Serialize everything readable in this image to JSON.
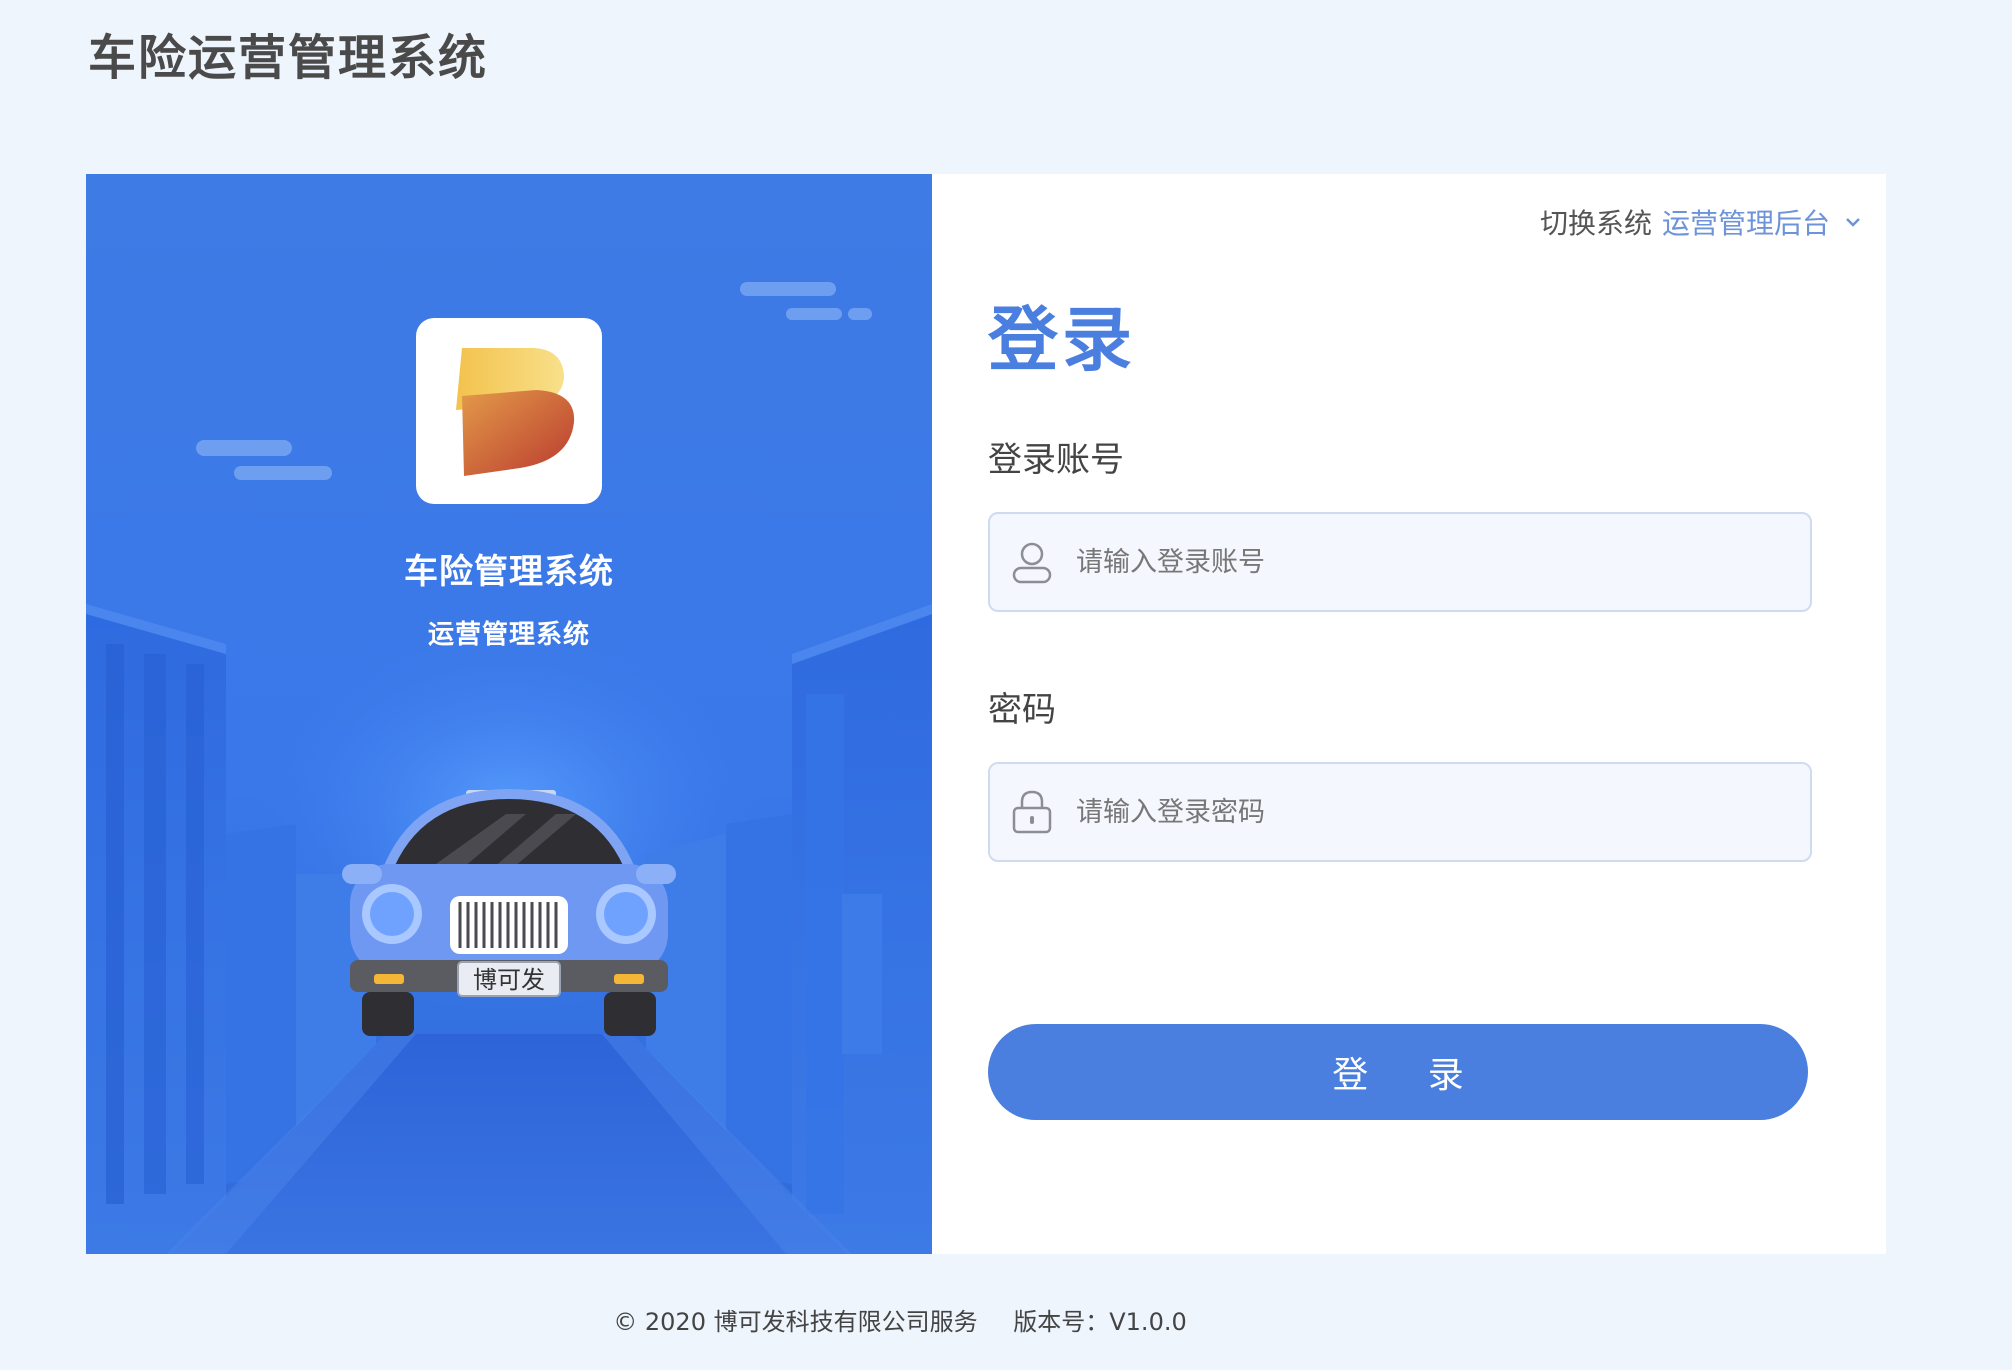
{
  "header": {
    "title": "车险运营管理系统"
  },
  "hero": {
    "title": "车险管理系统",
    "subtitle": "运营管理系统",
    "plate_text": "博可发",
    "logo_letter": "B"
  },
  "system_switch": {
    "label": "切换系统",
    "value": "运营管理后台",
    "icon": "chevron-down-icon"
  },
  "login": {
    "title": "登录",
    "account_label": "登录账号",
    "account_placeholder": "请输入登录账号",
    "account_value": "",
    "password_label": "密码",
    "password_placeholder": "请输入登录密码",
    "password_value": "",
    "submit_label": "登 录"
  },
  "footer": {
    "copyright": "© 2020 博可发科技有限公司服务",
    "version": "版本号：V1.0.0"
  },
  "colors": {
    "brand": "#4a7fe0",
    "hero_bg": "#3a78ea",
    "page_bg": "#eef5fd"
  }
}
